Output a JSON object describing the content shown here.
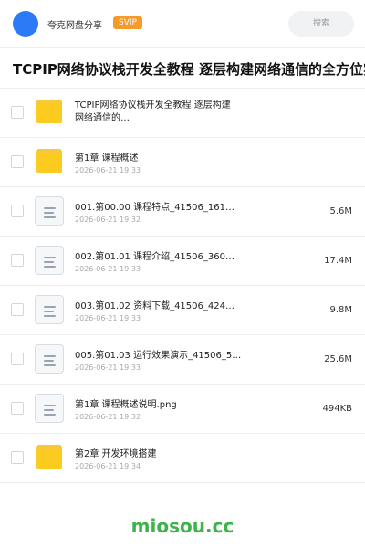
{
  "header": {
    "share_name": "夸克网盘分享",
    "badge": "SVIP",
    "search_placeholder": "搜索"
  },
  "page_title": "TCPIP网络协议栈开发全教程 逐层构建网络通信的全方位实",
  "files": [
    {
      "type": "folder",
      "name": "TCPIP网络协议栈开发全教程 逐层构建网络通信的…",
      "date": "",
      "size": ""
    },
    {
      "type": "folder",
      "name": "第1章 课程概述",
      "date": "2026-06-21 19:33",
      "size": ""
    },
    {
      "type": "doc",
      "name": "001.第00.00 课程特点_41506_161…",
      "date": "2026-06-21 19:32",
      "size": "5.6M"
    },
    {
      "type": "doc",
      "name": "002.第01.01 课程介绍_41506_360…",
      "date": "2026-06-21 19:33",
      "size": "17.4M"
    },
    {
      "type": "doc",
      "name": "003.第01.02 资料下载_41506_424…",
      "date": "2026-06-21 19:33",
      "size": "9.8M"
    },
    {
      "type": "doc",
      "name": "005.第01.03 运行效果演示_41506_5…",
      "date": "2026-06-21 19:33",
      "size": "25.6M"
    },
    {
      "type": "doc",
      "name": "第1章 课程概述说明.png",
      "date": "2026-06-21 19:32",
      "size": "494KB"
    },
    {
      "type": "folder",
      "name": "第2章 开发环境搭建",
      "date": "2026-06-21 19:34",
      "size": ""
    }
  ],
  "watermark": "miosou.cc",
  "colors": {
    "accent": "#2b7bf6",
    "badge": "#f79a2c",
    "folder": "#fccb1f",
    "watermark": "#3db34a"
  }
}
